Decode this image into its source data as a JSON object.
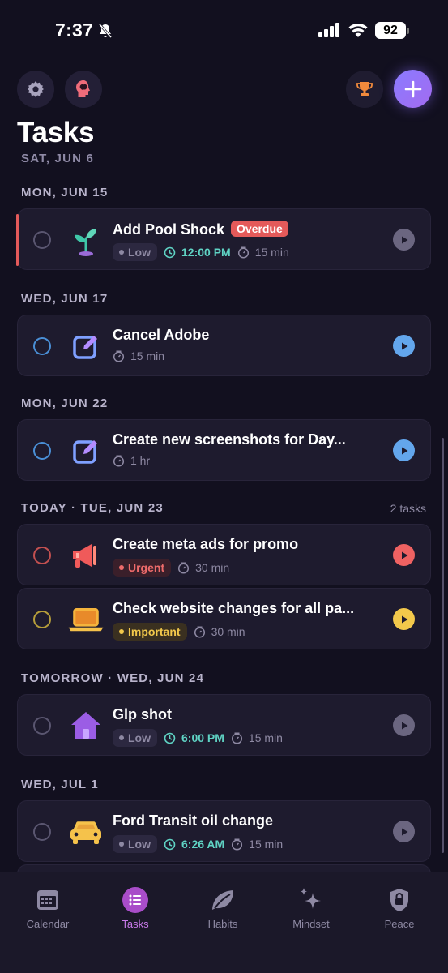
{
  "status_bar": {
    "time": "7:37",
    "battery": "92"
  },
  "header": {
    "title": "Tasks"
  },
  "list": {
    "cut_header": "SAT, JUN 6",
    "sections": [
      {
        "header": "MON, JUN 15",
        "tasks": [
          {
            "title": "Add Pool Shock",
            "badge": "Overdue",
            "priority": "Low",
            "time": "12:00 PM",
            "duration": "15 min",
            "icon": "sprout-icon"
          }
        ]
      },
      {
        "header": "WED, JUN 17",
        "tasks": [
          {
            "title": "Cancel Adobe",
            "duration": "15 min",
            "icon": "edit-icon"
          }
        ]
      },
      {
        "header": "MON, JUN 22",
        "tasks": [
          {
            "title": "Create new screenshots for Day...",
            "duration": "1 hr",
            "icon": "edit-icon"
          }
        ]
      },
      {
        "header": "TODAY · TUE, JUN 23",
        "count": "2 tasks",
        "tasks": [
          {
            "title": "Create meta ads for promo",
            "priority": "Urgent",
            "duration": "30 min",
            "icon": "megaphone-icon"
          },
          {
            "title": "Check website changes for all pa...",
            "priority": "Important",
            "duration": "30 min",
            "icon": "laptop-icon"
          }
        ]
      },
      {
        "header": "TOMORROW · WED, JUN 24",
        "tasks": [
          {
            "title": "Glp shot",
            "priority": "Low",
            "time": "6:00 PM",
            "duration": "15 min",
            "icon": "home-icon"
          }
        ]
      },
      {
        "header": "WED, JUL 1",
        "tasks": [
          {
            "title": "Ford Transit oil change",
            "priority": "Low",
            "time": "6:26 AM",
            "duration": "15 min",
            "icon": "car-icon"
          }
        ]
      }
    ]
  },
  "tab_bar": {
    "tabs": [
      {
        "label": "Calendar",
        "icon": "calendar-icon"
      },
      {
        "label": "Tasks",
        "icon": "list-icon",
        "active": true
      },
      {
        "label": "Habits",
        "icon": "leaf-icon"
      },
      {
        "label": "Mindset",
        "icon": "sparkles-icon"
      },
      {
        "label": "Peace",
        "icon": "lock-icon"
      }
    ]
  },
  "colors": {
    "background": "#12101f",
    "card": "#1e1b2e",
    "accent": "#a36bf0",
    "overdue": "#e45a5a",
    "time": "#5fd3c4",
    "urgent": "#ef6262",
    "important": "#f2c84b"
  }
}
